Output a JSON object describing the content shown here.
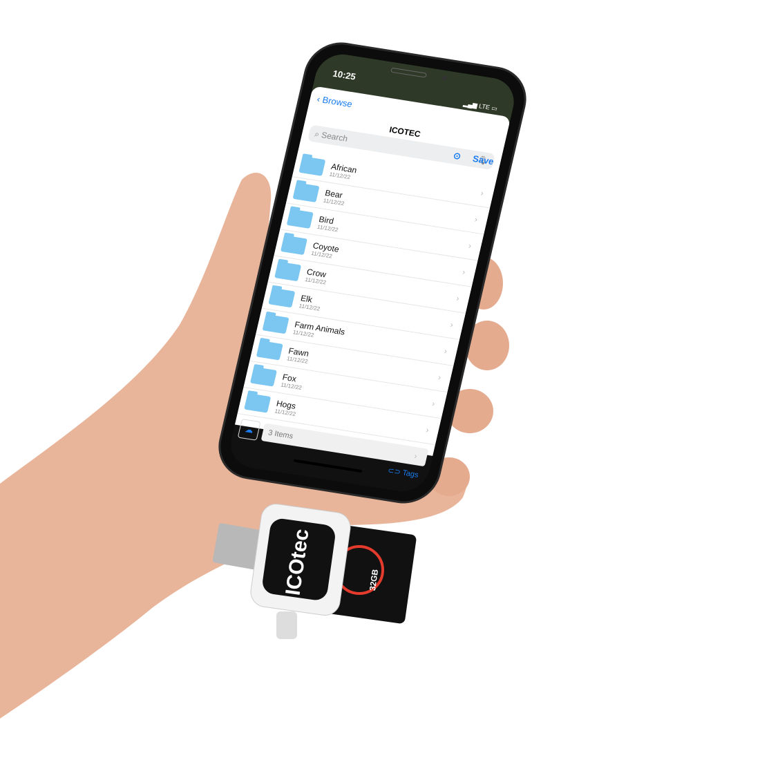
{
  "status": {
    "time": "10:25",
    "network": "LTE"
  },
  "nav": {
    "back_label": "Browse",
    "title": "ICOTEC",
    "save_label": "Save",
    "more_icon": "ellipsis-circle-icon"
  },
  "search": {
    "placeholder": "Search"
  },
  "folders": [
    {
      "name": "African",
      "date": "11/12/22"
    },
    {
      "name": "Bear",
      "date": "11/12/22"
    },
    {
      "name": "Bird",
      "date": "11/12/22"
    },
    {
      "name": "Coyote",
      "date": "11/12/22"
    },
    {
      "name": "Crow",
      "date": "11/12/22"
    },
    {
      "name": "Elk",
      "date": "11/12/22"
    },
    {
      "name": "Farm Animals",
      "date": "11/12/22"
    },
    {
      "name": "Fawn",
      "date": "11/12/22"
    },
    {
      "name": "Fox",
      "date": "11/12/22"
    },
    {
      "name": "Hogs",
      "date": "11/12/22"
    }
  ],
  "footer": {
    "items_label": "3 Items",
    "tags_label": "Tags"
  },
  "adapter": {
    "brand": "ICOtec",
    "card_brand": "ICOtec",
    "card_capacity": "32GB"
  },
  "colors": {
    "accent": "#1a7cf0",
    "folder": "#7cc6f2",
    "status_bg": "#2e3a27",
    "skin": "#e9b59a"
  }
}
